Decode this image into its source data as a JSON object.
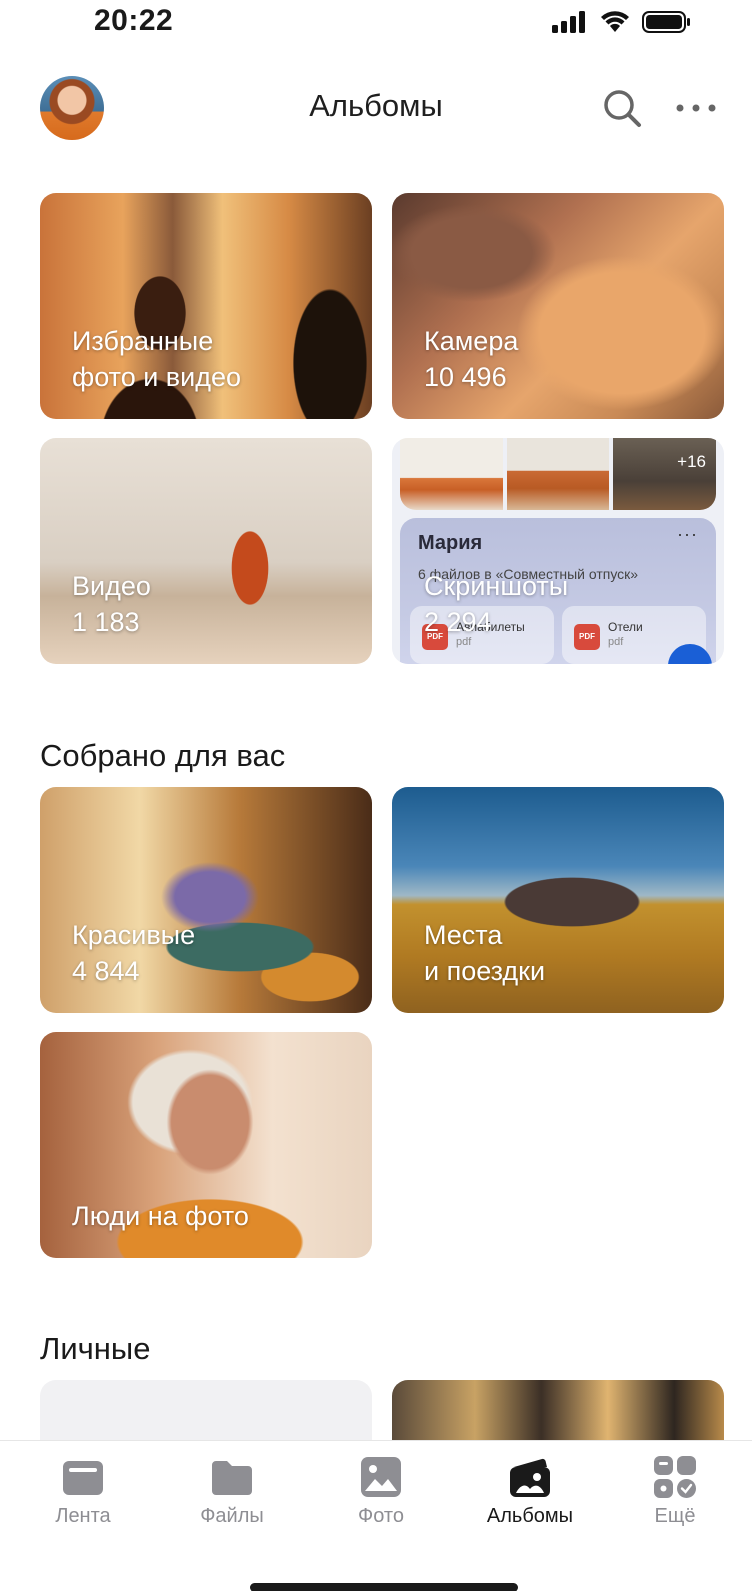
{
  "status_bar": {
    "time": "20:22"
  },
  "header": {
    "title": "Альбомы"
  },
  "albums": {
    "favorites": {
      "line1": "Избранные",
      "line2": "фото и видео"
    },
    "camera": {
      "name": "Камера",
      "count": "10 496"
    },
    "video": {
      "name": "Видео",
      "count": "1 183"
    },
    "screenshots": {
      "name": "Скриншоты",
      "count": "2 294",
      "preview": {
        "more_count": "+16",
        "author": "Мария",
        "dots": "···",
        "subtitle": "6 файлов в «Совместный отпуск»",
        "files": [
          {
            "name": "Авиабилеты",
            "type": "pdf"
          },
          {
            "name": "Отели",
            "type": "pdf"
          }
        ],
        "pdf_badge": "PDF"
      }
    }
  },
  "collected": {
    "title": "Собрано для вас",
    "beautiful": {
      "name": "Красивые",
      "count": "4 844"
    },
    "places": {
      "line1": "Места",
      "line2": "и поездки"
    },
    "people": {
      "name": "Люди на фото"
    }
  },
  "personal": {
    "title": "Личные"
  },
  "tab_bar": {
    "tabs": [
      {
        "label": "Лента"
      },
      {
        "label": "Файлы"
      },
      {
        "label": "Фото"
      },
      {
        "label": "Альбомы",
        "active": true
      },
      {
        "label": "Ещё"
      }
    ]
  },
  "colors": {
    "active_tab": "#1a1a1a",
    "inactive_tab": "#8e8e93",
    "fab": "#1a5fd6"
  }
}
